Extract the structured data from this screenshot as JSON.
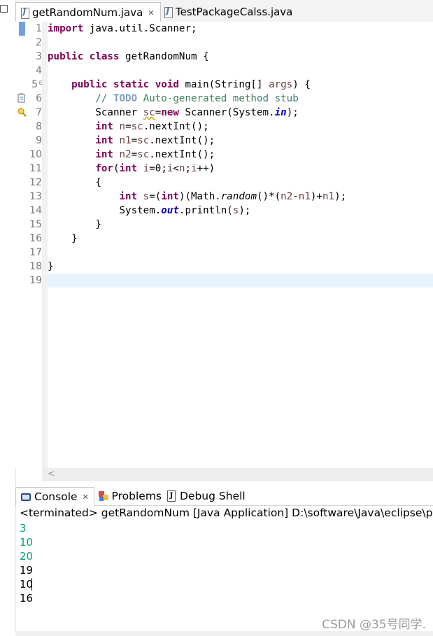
{
  "editor_tabs": [
    {
      "label": "getRandomNum.java",
      "close": "✕",
      "active": true
    },
    {
      "label": "TestPackageCalss.java",
      "active": false
    }
  ],
  "editor": {
    "line_numbers": [
      "1",
      "2",
      "3",
      "4",
      "5",
      "6",
      "7",
      "8",
      "9",
      "10",
      "11",
      "12",
      "13",
      "14",
      "15",
      "16",
      "17",
      "18",
      "19"
    ],
    "fold_marker": "⊖"
  },
  "console": {
    "tabs": [
      {
        "label": "Console",
        "close": "✕",
        "active": true
      },
      {
        "label": "Problems"
      },
      {
        "label": "Debug Shell"
      }
    ],
    "status": "<terminated> getRandomNum [Java Application] D:\\software\\Java\\eclipse\\plugins",
    "input_lines": [
      "3",
      "10",
      "20"
    ],
    "output_lines": [
      "19",
      "10",
      "16"
    ]
  },
  "watermark": "CSDN @35号同学.",
  "icons": {
    "file": "java-file-icon",
    "console": "console-icon",
    "problems": "problems-icon",
    "debug_shell": "debug-shell-icon"
  }
}
